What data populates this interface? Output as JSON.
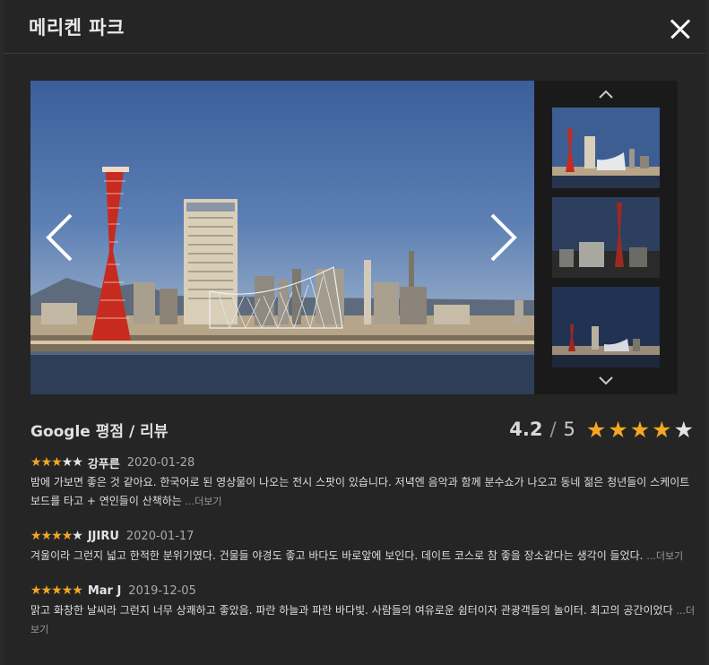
{
  "modal": {
    "title": "메리켄 파크"
  },
  "rating": {
    "title": "Google 평점 / 리뷰",
    "score": "4.2",
    "sep": "/",
    "max": "5",
    "stars_filled": 4
  },
  "reviews": [
    {
      "stars": 3,
      "author": "강푸른",
      "date": "2020-01-28",
      "text": "밤에 가보면 좋은 것 같아요. 한국어로 된 영상물이 나오는 전시 스팟이 있습니다. 저녁엔 음악과 함께 분수쇼가 나오고 동네 젊은 청년들이 스케이트보드를 타고 + 연인들이 산책하는",
      "more": "...더보기"
    },
    {
      "stars": 4,
      "author": "JJIRU",
      "date": "2020-01-17",
      "text": "겨울이라 그런지 넓고 한적한 분위기였다. 건물들 야경도 좋고 바다도 바로앞에 보인다. 데이트 코스로 참 좋을 장소같다는 생각이 들었다.",
      "more": "...더보기"
    },
    {
      "stars": 5,
      "author": "Mar J",
      "date": "2019-12-05",
      "text": "맑고 화창한 날씨라 그런지 너무 상쾌하고 좋았음. 파란 하늘과 파란 바다빛. 사람들의 여유로운 쉼터이자 관광객들의 놀이터. 최고의 공간이었다",
      "more": "...더보기"
    }
  ]
}
